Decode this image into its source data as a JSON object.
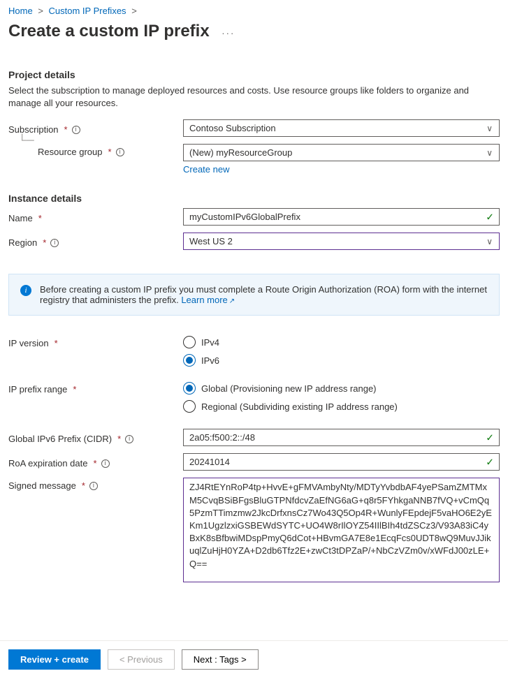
{
  "breadcrumb": {
    "home": "Home",
    "custom_ip": "Custom IP Prefixes"
  },
  "title": "Create a custom IP prefix",
  "sections": {
    "project": {
      "title": "Project details",
      "desc": "Select the subscription to manage deployed resources and costs. Use resource groups like folders to organize and manage all your resources."
    },
    "instance": {
      "title": "Instance details"
    }
  },
  "fields": {
    "subscription": {
      "label": "Subscription",
      "value": "Contoso Subscription"
    },
    "resource_group": {
      "label": "Resource group",
      "value": "(New) myResourceGroup",
      "create": "Create new"
    },
    "name": {
      "label": "Name",
      "value": "myCustomIPv6GlobalPrefix"
    },
    "region": {
      "label": "Region",
      "value": "West US 2"
    },
    "ip_version": {
      "label": "IP version",
      "options": [
        "IPv4",
        "IPv6"
      ],
      "selected": 1
    },
    "ip_prefix_range": {
      "label": "IP prefix range",
      "options": [
        "Global (Provisioning new IP address range)",
        "Regional (Subdividing existing IP address range)"
      ],
      "selected": 0
    },
    "cidr": {
      "label": "Global IPv6 Prefix (CIDR)",
      "value": "2a05:f500:2::/48"
    },
    "roa": {
      "label": "RoA expiration date",
      "value": "20241014"
    },
    "signed": {
      "label": "Signed message",
      "value": "ZJ4RtEYnRoP4tp+HvvE+gFMVAmbyNty/MDTyYvbdbAF4yePSamZMTMxM5CvqBSiBFgsBluGTPNfdcvZaEfNG6aG+q8r5FYhkgaNNB7fVQ+vCmQq5PzmTTimzmw2JkcDrfxnsCz7Wo43Q5Op4R+WunlyFEpdejF5vaHO6E2yEKm1UgzlzxiGSBEWdSYTC+UO4W8rIlOYZ54IIlBIh4tdZSCz3/V93A83iC4yBxK8sBfbwiMDspPmyQ6dCot+HBvmGA7E8e1EcqFcs0UDT8wQ9MuvJJikuqlZuHjH0YZA+D2db6Tfz2E+zwCt3tDPZaP/+NbCzVZm0v/xWFdJ00zLE+Q=="
    }
  },
  "infobox": {
    "text": "Before creating a custom IP prefix you must complete a Route Origin Authorization (ROA) form with the internet registry that administers the prefix. ",
    "link": "Learn more"
  },
  "footer": {
    "review": "Review + create",
    "prev": "< Previous",
    "next": "Next : Tags >"
  }
}
